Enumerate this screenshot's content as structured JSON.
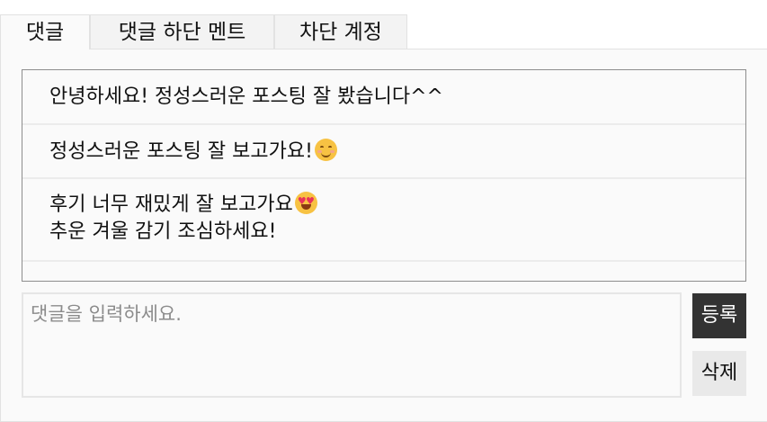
{
  "tabs": [
    {
      "label": "댓글",
      "active": true
    },
    {
      "label": "댓글 하단 멘트",
      "active": false
    },
    {
      "label": "차단 계정",
      "active": false
    }
  ],
  "comments": [
    {
      "lines": [
        "안녕하세요! 정성스러운 포스팅 잘 봤습니다^^"
      ]
    },
    {
      "lines": [
        "정성스러운 포스팅 잘 보고가요!"
      ],
      "emoji": "smiling-face-emoji"
    },
    {
      "lines": [
        "후기 너무 재밌게 잘 보고가요",
        "추운 겨울 감기 조심하세요!"
      ],
      "emoji": "heart-eyes-emoji"
    }
  ],
  "input": {
    "placeholder": "댓글을 입력하세요.",
    "value": ""
  },
  "buttons": {
    "submit": "등록",
    "delete": "삭제"
  },
  "colors": {
    "submit_bg": "#333333",
    "delete_bg": "#e9e9e9",
    "panel_bg": "#fafafa"
  }
}
